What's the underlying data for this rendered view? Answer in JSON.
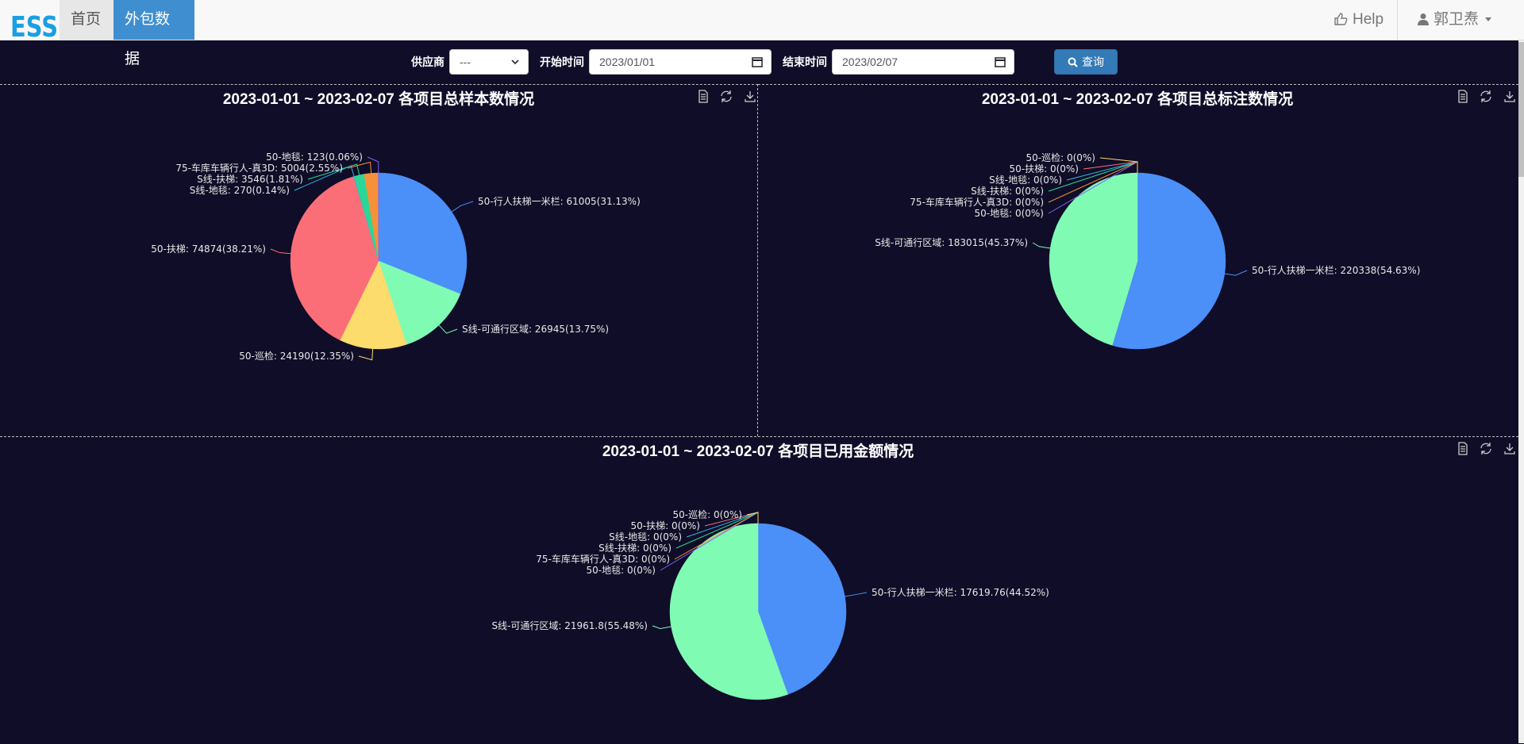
{
  "nav": {
    "logo": "ESS",
    "home": "首页",
    "outsource": "外包数据",
    "help": "Help",
    "user": "郭卫焘"
  },
  "filters": {
    "supplier_label": "供应商",
    "supplier_value": "---",
    "start_label": "开始时间",
    "start_value": "2023/01/01",
    "end_label": "结束时间",
    "end_value": "2023/02/07",
    "query_label": "查询"
  },
  "chart_data": [
    {
      "type": "pie",
      "title": "2023-01-01 ~ 2023-02-07 各项目总样本数情况",
      "slices": [
        {
          "name": "50-行人扶梯一米栏",
          "value": 61005,
          "percent": 31.13,
          "color": "#4b8ff8"
        },
        {
          "name": "S线-可通行区域",
          "value": 26945,
          "percent": 13.75,
          "color": "#7ffbb4"
        },
        {
          "name": "50-巡检",
          "value": 24190,
          "percent": 12.35,
          "color": "#fcdc6c"
        },
        {
          "name": "50-扶梯",
          "value": 74874,
          "percent": 38.21,
          "color": "#fb6e78"
        },
        {
          "name": "S线-地毯",
          "value": 270,
          "percent": 0.14,
          "color": "#2fb6e8"
        },
        {
          "name": "S线-扶梯",
          "value": 3546,
          "percent": 1.81,
          "color": "#2bd796"
        },
        {
          "name": "75-车库车辆行人-真3D",
          "value": 5004,
          "percent": 2.55,
          "color": "#f6913a"
        },
        {
          "name": "50-地毯",
          "value": 123,
          "percent": 0.06,
          "color": "#7b64f3"
        }
      ],
      "labels": [
        "50-行人扶梯一米栏: 61005(31.13%)",
        "S线-可通行区域: 26945(13.75%)",
        "50-巡检: 24190(12.35%)",
        "50-扶梯: 74874(38.21%)",
        "S线-地毯: 270(0.14%)",
        "S线-扶梯: 3546(1.81%)",
        "75-车库车辆行人-真3D: 5004(2.55%)",
        "50-地毯: 123(0.06%)"
      ]
    },
    {
      "type": "pie",
      "title": "2023-01-01 ~ 2023-02-07 各项目总标注数情况",
      "slices": [
        {
          "name": "50-行人扶梯一米栏",
          "value": 220338,
          "percent": 54.63,
          "color": "#4b8ff8"
        },
        {
          "name": "S线-可通行区域",
          "value": 183015,
          "percent": 45.37,
          "color": "#7ffbb4"
        },
        {
          "name": "50-地毯",
          "value": 0,
          "percent": 0,
          "color": "#7b64f3"
        },
        {
          "name": "75-车库车辆行人-真3D",
          "value": 0,
          "percent": 0,
          "color": "#f6913a"
        },
        {
          "name": "S线-扶梯",
          "value": 0,
          "percent": 0,
          "color": "#2bd796"
        },
        {
          "name": "S线-地毯",
          "value": 0,
          "percent": 0,
          "color": "#2fb6e8"
        },
        {
          "name": "50-扶梯",
          "value": 0,
          "percent": 0,
          "color": "#fb6e78"
        },
        {
          "name": "50-巡检",
          "value": 0,
          "percent": 0,
          "color": "#fcdc6c"
        }
      ],
      "labels": [
        "50-行人扶梯一米栏: 220338(54.63%)",
        "S线-可通行区域: 183015(45.37%)",
        "50-地毯: 0(0%)",
        "75-车库车辆行人-真3D: 0(0%)",
        "S线-扶梯: 0(0%)",
        "S线-地毯: 0(0%)",
        "50-扶梯: 0(0%)",
        "50-巡检: 0(0%)"
      ]
    },
    {
      "type": "pie",
      "title": "2023-01-01 ~ 2023-02-07 各项目已用金额情况",
      "slices": [
        {
          "name": "50-行人扶梯一米栏",
          "value": 17619.76,
          "percent": 44.52,
          "color": "#4b8ff8"
        },
        {
          "name": "S线-可通行区域",
          "value": 21961.8,
          "percent": 55.48,
          "color": "#7ffbb4"
        },
        {
          "name": "50-地毯",
          "value": 0,
          "percent": 0,
          "color": "#7b64f3"
        },
        {
          "name": "75-车库车辆行人-真3D",
          "value": 0,
          "percent": 0,
          "color": "#f6913a"
        },
        {
          "name": "S线-扶梯",
          "value": 0,
          "percent": 0,
          "color": "#2bd796"
        },
        {
          "name": "S线-地毯",
          "value": 0,
          "percent": 0,
          "color": "#2fb6e8"
        },
        {
          "name": "50-扶梯",
          "value": 0,
          "percent": 0,
          "color": "#fb6e78"
        },
        {
          "name": "50-巡检",
          "value": 0,
          "percent": 0,
          "color": "#fcdc6c"
        }
      ],
      "labels": [
        "50-行人扶梯一米栏: 17619.76(44.52%)",
        "S线-可通行区域: 21961.8(55.48%)",
        "50-地毯: 0(0%)",
        "75-车库车辆行人-真3D: 0(0%)",
        "S线-扶梯: 0(0%)",
        "S线-地毯: 0(0%)",
        "50-扶梯: 0(0%)",
        "50-巡检: 0(0%)"
      ]
    }
  ]
}
